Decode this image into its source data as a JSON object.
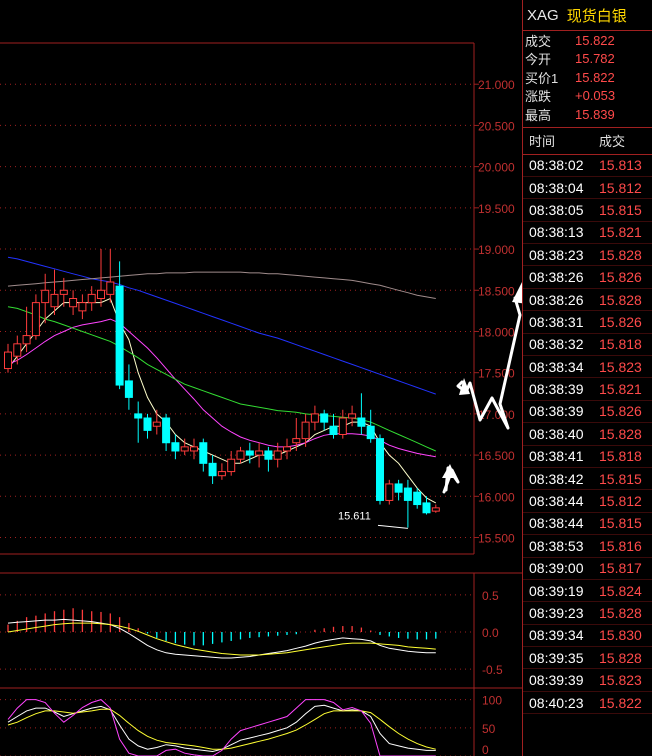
{
  "quote": {
    "symbol": "XAG",
    "name": "现货白银",
    "fields": [
      {
        "label": "成交",
        "value": "15.822"
      },
      {
        "label": "今开",
        "value": "15.782"
      },
      {
        "label": "买价1",
        "value": "15.822"
      },
      {
        "label": "涨跌",
        "value": "+0.053"
      },
      {
        "label": "最高",
        "value": "15.839"
      }
    ]
  },
  "ticks": {
    "header": {
      "time": "时间",
      "price": "成交"
    },
    "rows": [
      {
        "time": "08:38:02",
        "price": "15.813"
      },
      {
        "time": "08:38:04",
        "price": "15.812"
      },
      {
        "time": "08:38:05",
        "price": "15.815"
      },
      {
        "time": "08:38:13",
        "price": "15.821"
      },
      {
        "time": "08:38:23",
        "price": "15.828"
      },
      {
        "time": "08:38:26",
        "price": "15.826"
      },
      {
        "time": "08:38:26",
        "price": "15.828"
      },
      {
        "time": "08:38:31",
        "price": "15.826"
      },
      {
        "time": "08:38:32",
        "price": "15.818"
      },
      {
        "time": "08:38:34",
        "price": "15.823"
      },
      {
        "time": "08:38:39",
        "price": "15.821"
      },
      {
        "time": "08:38:39",
        "price": "15.826"
      },
      {
        "time": "08:38:40",
        "price": "15.828"
      },
      {
        "time": "08:38:41",
        "price": "15.818"
      },
      {
        "time": "08:38:42",
        "price": "15.815"
      },
      {
        "time": "08:38:44",
        "price": "15.812"
      },
      {
        "time": "08:38:44",
        "price": "15.815"
      },
      {
        "time": "08:38:53",
        "price": "15.816"
      },
      {
        "time": "08:39:00",
        "price": "15.817"
      },
      {
        "time": "08:39:19",
        "price": "15.824"
      },
      {
        "time": "08:39:23",
        "price": "15.828"
      },
      {
        "time": "08:39:34",
        "price": "15.830"
      },
      {
        "time": "08:39:35",
        "price": "15.828"
      },
      {
        "time": "08:39:39",
        "price": "15.823"
      },
      {
        "time": "08:40:23",
        "price": "15.822"
      }
    ]
  },
  "colors": {
    "up": "#ff3c3c",
    "down": "#00ffff",
    "grid": "#a02020",
    "axis": "#c03030"
  },
  "chart_data": {
    "type": "candlestick",
    "y_ticks": [
      "21.000",
      "20.500",
      "20.000",
      "19.500",
      "19.000",
      "18.500",
      "18.000",
      "17.500",
      "17.000",
      "16.500",
      "16.000",
      "15.500"
    ],
    "ylim": [
      15.3,
      21.5
    ],
    "annotation": "15.611",
    "candles": [
      [
        17.55,
        17.75,
        17.5,
        17.85
      ],
      [
        17.7,
        17.85,
        17.6,
        17.95
      ],
      [
        17.85,
        17.95,
        17.75,
        18.3
      ],
      [
        17.95,
        18.35,
        17.9,
        18.45
      ],
      [
        18.35,
        18.5,
        18.1,
        18.7
      ],
      [
        18.3,
        18.45,
        18.2,
        18.75
      ],
      [
        18.45,
        18.5,
        18.3,
        18.65
      ],
      [
        18.3,
        18.4,
        18.2,
        18.5
      ],
      [
        18.25,
        18.35,
        18.15,
        18.45
      ],
      [
        18.35,
        18.45,
        18.25,
        18.55
      ],
      [
        18.4,
        18.5,
        18.3,
        19.0
      ],
      [
        18.45,
        18.6,
        18.35,
        19.0
      ],
      [
        18.55,
        17.35,
        17.3,
        18.85
      ],
      [
        17.4,
        17.2,
        17.05,
        17.6
      ],
      [
        17.0,
        16.95,
        16.65,
        17.15
      ],
      [
        16.95,
        16.8,
        16.7,
        17.0
      ],
      [
        16.85,
        16.9,
        16.75,
        17.05
      ],
      [
        16.95,
        16.65,
        16.55,
        17.0
      ],
      [
        16.65,
        16.55,
        16.45,
        16.75
      ],
      [
        16.55,
        16.6,
        16.5,
        16.7
      ],
      [
        16.55,
        16.6,
        16.45,
        16.7
      ],
      [
        16.65,
        16.4,
        16.3,
        16.7
      ],
      [
        16.4,
        16.25,
        16.15,
        16.5
      ],
      [
        16.25,
        16.3,
        16.2,
        16.4
      ],
      [
        16.3,
        16.45,
        16.25,
        16.55
      ],
      [
        16.45,
        16.55,
        16.4,
        16.6
      ],
      [
        16.55,
        16.5,
        16.4,
        16.65
      ],
      [
        16.5,
        16.55,
        16.35,
        16.65
      ],
      [
        16.55,
        16.45,
        16.3,
        16.6
      ],
      [
        16.45,
        16.55,
        16.35,
        16.65
      ],
      [
        16.55,
        16.6,
        16.45,
        16.7
      ],
      [
        16.65,
        16.7,
        16.55,
        16.95
      ],
      [
        16.7,
        16.9,
        16.6,
        17.0
      ],
      [
        16.9,
        17.0,
        16.8,
        17.1
      ],
      [
        17.0,
        16.9,
        16.8,
        17.05
      ],
      [
        16.85,
        16.75,
        16.7,
        17.0
      ],
      [
        16.75,
        16.95,
        16.7,
        17.05
      ],
      [
        16.95,
        17.0,
        16.85,
        17.1
      ],
      [
        16.95,
        16.85,
        16.75,
        17.25
      ],
      [
        16.85,
        16.7,
        16.65,
        17.05
      ],
      [
        16.7,
        15.95,
        15.9,
        16.75
      ],
      [
        15.95,
        16.15,
        15.9,
        16.2
      ],
      [
        16.15,
        16.05,
        15.95,
        16.2
      ],
      [
        16.1,
        15.95,
        15.62,
        16.2
      ],
      [
        16.05,
        15.9,
        15.85,
        16.1
      ],
      [
        15.92,
        15.8,
        15.78,
        16.0
      ],
      [
        15.82,
        15.86,
        15.8,
        15.9
      ]
    ],
    "ma_series": [
      {
        "color": "#ffffcc",
        "values": [
          17.55,
          17.7,
          17.85,
          18.0,
          18.15,
          18.25,
          18.35,
          18.35,
          18.35,
          18.35,
          18.35,
          18.4,
          18.1,
          17.9,
          17.5,
          17.2,
          17.0,
          16.9,
          16.75,
          16.65,
          16.6,
          16.55,
          16.5,
          16.45,
          16.4,
          16.4,
          16.45,
          16.5,
          16.5,
          16.5,
          16.55,
          16.6,
          16.65,
          16.75,
          16.8,
          16.85,
          16.85,
          16.9,
          16.9,
          16.85,
          16.65,
          16.5,
          16.4,
          16.25,
          16.1,
          15.98,
          15.92
        ]
      },
      {
        "color": "#ff44ff",
        "values": [
          17.6,
          17.65,
          17.72,
          17.8,
          17.88,
          17.95,
          18.0,
          18.05,
          18.08,
          18.1,
          18.12,
          18.15,
          18.1,
          18.0,
          17.9,
          17.8,
          17.68,
          17.55,
          17.42,
          17.3,
          17.18,
          17.05,
          16.95,
          16.85,
          16.78,
          16.72,
          16.68,
          16.65,
          16.62,
          16.6,
          16.6,
          16.62,
          16.65,
          16.7,
          16.74,
          16.76,
          16.76,
          16.76,
          16.75,
          16.73,
          16.68,
          16.62,
          16.58,
          16.55,
          16.52,
          16.5,
          16.48
        ]
      },
      {
        "color": "#33dd33",
        "values": [
          18.3,
          18.28,
          18.24,
          18.2,
          18.15,
          18.12,
          18.08,
          18.04,
          18.0,
          17.96,
          17.92,
          17.88,
          17.82,
          17.75,
          17.68,
          17.6,
          17.54,
          17.48,
          17.42,
          17.36,
          17.32,
          17.28,
          17.24,
          17.2,
          17.16,
          17.12,
          17.1,
          17.08,
          17.06,
          17.04,
          17.03,
          17.02,
          17.0,
          16.99,
          16.98,
          16.97,
          16.96,
          16.95,
          16.93,
          16.9,
          16.85,
          16.8,
          16.75,
          16.7,
          16.65,
          16.6,
          16.55
        ]
      },
      {
        "color": "#2233ff",
        "values": [
          18.9,
          18.88,
          18.85,
          18.82,
          18.79,
          18.76,
          18.73,
          18.7,
          18.67,
          18.64,
          18.62,
          18.6,
          18.57,
          18.53,
          18.5,
          18.46,
          18.42,
          18.38,
          18.34,
          18.3,
          18.26,
          18.22,
          18.18,
          18.14,
          18.1,
          18.06,
          18.02,
          17.98,
          17.95,
          17.92,
          17.88,
          17.84,
          17.8,
          17.76,
          17.72,
          17.68,
          17.64,
          17.6,
          17.56,
          17.52,
          17.48,
          17.44,
          17.4,
          17.36,
          17.32,
          17.28,
          17.24
        ]
      },
      {
        "color": "#a08c8c",
        "values": [
          18.55,
          18.56,
          18.57,
          18.58,
          18.59,
          18.6,
          18.61,
          18.62,
          18.63,
          18.64,
          18.65,
          18.66,
          18.67,
          18.68,
          18.69,
          18.7,
          18.7,
          18.71,
          18.71,
          18.71,
          18.72,
          18.72,
          18.72,
          18.72,
          18.72,
          18.72,
          18.71,
          18.71,
          18.7,
          18.7,
          18.69,
          18.68,
          18.67,
          18.66,
          18.65,
          18.64,
          18.63,
          18.62,
          18.6,
          18.58,
          18.56,
          18.53,
          18.5,
          18.47,
          18.44,
          18.42,
          18.4
        ]
      }
    ],
    "macd": {
      "y_ticks": [
        "0.5",
        "0.0",
        "-0.5"
      ],
      "ylim": [
        -0.7,
        0.7
      ],
      "hist": [
        0.1,
        0.15,
        0.2,
        0.22,
        0.25,
        0.28,
        0.3,
        0.32,
        0.3,
        0.28,
        0.27,
        0.25,
        0.2,
        0.12,
        0.05,
        -0.02,
        -0.08,
        -0.12,
        -0.15,
        -0.17,
        -0.18,
        -0.18,
        -0.16,
        -0.14,
        -0.12,
        -0.1,
        -0.08,
        -0.07,
        -0.06,
        -0.05,
        -0.04,
        -0.03,
        0.0,
        0.03,
        0.05,
        0.07,
        0.08,
        0.08,
        0.06,
        0.02,
        -0.04,
        -0.06,
        -0.08,
        -0.09,
        -0.1,
        -0.1,
        -0.09
      ],
      "dif": [
        0.12,
        0.13,
        0.14,
        0.15,
        0.16,
        0.16,
        0.17,
        0.16,
        0.15,
        0.14,
        0.12,
        0.1,
        0.05,
        -0.02,
        -0.1,
        -0.18,
        -0.24,
        -0.28,
        -0.3,
        -0.31,
        -0.32,
        -0.33,
        -0.34,
        -0.35,
        -0.35,
        -0.34,
        -0.33,
        -0.31,
        -0.29,
        -0.27,
        -0.25,
        -0.22,
        -0.19,
        -0.15,
        -0.12,
        -0.1,
        -0.08,
        -0.09,
        -0.1,
        -0.12,
        -0.18,
        -0.22,
        -0.24,
        -0.26,
        -0.27,
        -0.28,
        -0.28
      ],
      "dea": [
        0.0,
        0.02,
        0.04,
        0.06,
        0.08,
        0.1,
        0.11,
        0.12,
        0.12,
        0.12,
        0.11,
        0.1,
        0.08,
        0.05,
        0.01,
        -0.04,
        -0.09,
        -0.13,
        -0.17,
        -0.2,
        -0.23,
        -0.25,
        -0.27,
        -0.29,
        -0.3,
        -0.31,
        -0.31,
        -0.31,
        -0.3,
        -0.29,
        -0.28,
        -0.26,
        -0.24,
        -0.22,
        -0.2,
        -0.18,
        -0.16,
        -0.15,
        -0.15,
        -0.15,
        -0.16,
        -0.17,
        -0.18,
        -0.2,
        -0.21,
        -0.22,
        -0.23
      ]
    },
    "kdj": {
      "y_ticks": [
        "100",
        "50",
        "0"
      ],
      "ylim": [
        0,
        110
      ],
      "k": [
        60,
        70,
        80,
        85,
        85,
        78,
        70,
        75,
        80,
        85,
        88,
        82,
        55,
        30,
        18,
        12,
        15,
        20,
        18,
        14,
        12,
        10,
        8,
        12,
        20,
        28,
        32,
        36,
        40,
        45,
        50,
        60,
        75,
        88,
        90,
        85,
        80,
        82,
        80,
        70,
        40,
        22,
        18,
        14,
        12,
        10,
        10
      ],
      "d": [
        55,
        60,
        68,
        75,
        80,
        80,
        78,
        76,
        78,
        80,
        83,
        83,
        72,
        58,
        45,
        35,
        28,
        24,
        22,
        20,
        18,
        15,
        12,
        12,
        14,
        18,
        22,
        26,
        30,
        35,
        40,
        46,
        55,
        65,
        75,
        80,
        80,
        80,
        80,
        77,
        65,
        52,
        40,
        30,
        22,
        16,
        12
      ],
      "j": [
        65,
        85,
        100,
        100,
        95,
        76,
        60,
        72,
        86,
        95,
        100,
        85,
        30,
        5,
        0,
        0,
        0,
        10,
        12,
        5,
        2,
        0,
        0,
        10,
        30,
        45,
        50,
        55,
        60,
        65,
        70,
        85,
        100,
        100,
        100,
        95,
        82,
        86,
        80,
        58,
        0,
        0,
        0,
        0,
        0,
        0,
        0
      ]
    }
  }
}
